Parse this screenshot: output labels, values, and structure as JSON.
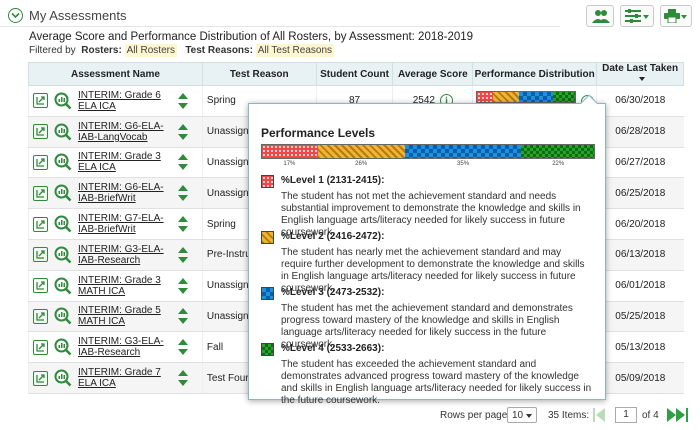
{
  "header": {
    "title": "My Assessments",
    "subtitle": "Average Score and Performance Distribution of All Rosters, by Assessment: 2018-2019",
    "filtered_by": "Filtered by",
    "rosters_label": "Rosters:",
    "rosters_value": "All Rosters",
    "reasons_label": "Test Reasons:",
    "reasons_value": "All Test Reasons"
  },
  "columns": {
    "name": "Assessment Name",
    "reason": "Test Reason",
    "count": "Student Count",
    "avg": "Average Score",
    "dist": "Performance Distribution",
    "date": "Date Last Taken"
  },
  "rows": [
    {
      "name": "INTERIM: Grade 6 ELA ICA",
      "reason": "Spring",
      "count": "87",
      "avg": "2542",
      "date": "06/30/2018"
    },
    {
      "name": "INTERIM: G6-ELA-IAB-LangVocab",
      "reason": "Unassigne",
      "count": "",
      "avg": "",
      "date": "06/28/2018"
    },
    {
      "name": "INTERIM: Grade 3 ELA ICA",
      "reason": "Unassigne",
      "count": "",
      "avg": "",
      "date": "06/27/2018"
    },
    {
      "name": "INTERIM: G6-ELA-IAB-BriefWrit",
      "reason": "Unassigne",
      "count": "",
      "avg": "",
      "date": "06/25/2018"
    },
    {
      "name": "INTERIM: G7-ELA-IAB-BriefWrit",
      "reason": "Spring",
      "count": "",
      "avg": "",
      "date": "06/20/2018"
    },
    {
      "name": "INTERIM: G3-ELA-IAB-Research",
      "reason": "Pre-Instruc",
      "count": "",
      "avg": "",
      "date": "06/13/2018"
    },
    {
      "name": "INTERIM: Grade 3 MATH ICA",
      "reason": "Unassigne",
      "count": "",
      "avg": "",
      "date": "06/01/2018"
    },
    {
      "name": "INTERIM: Grade 5 MATH ICA",
      "reason": "Unassigne",
      "count": "",
      "avg": "",
      "date": "05/25/2018"
    },
    {
      "name": "INTERIM: G3-ELA-IAB-Research",
      "reason": "Fall",
      "count": "",
      "avg": "",
      "date": "05/13/2018"
    },
    {
      "name": "INTERIM: Grade 7 ELA ICA",
      "reason": "Test Four",
      "count": "",
      "avg": "",
      "date": "05/09/2018"
    }
  ],
  "distribution": {
    "levels": [
      17,
      26,
      35,
      22
    ],
    "labels": [
      "17%",
      "26%",
      "35%",
      "22%"
    ]
  },
  "popup": {
    "title": "Performance Levels",
    "levels": [
      {
        "title": "%Level 1 (2131-2415):",
        "desc": "The student has not met the achievement standard and needs substantial improvement to demonstrate the knowledge and skills in English language arts/literacy needed for likely success in future coursework."
      },
      {
        "title": "%Level 2 (2416-2472):",
        "desc": "The student has nearly met the achievement standard and may require further development to demonstrate the knowledge and skills in English language arts/literacy needed for likely success in future coursework."
      },
      {
        "title": "%Level 3 (2473-2532):",
        "desc": "The student has met the achievement standard and demonstrates progress toward mastery of the knowledge and skills in English language arts/literacy needed for likely success in the future coursework."
      },
      {
        "title": "%Level 4 (2533-2663):",
        "desc": "The student has exceeded the achievement standard and demonstrates advanced progress toward mastery of the knowledge and skills in English language arts/literacy needed for likely success in the future coursework."
      }
    ]
  },
  "pager": {
    "rows_label": "Rows per page:",
    "rows_value": "10",
    "items": "35 Items:",
    "page": "1",
    "of": "of 4"
  },
  "colors": {
    "accent": "#2e8b3c",
    "header_bg": "#e8f1f4"
  }
}
